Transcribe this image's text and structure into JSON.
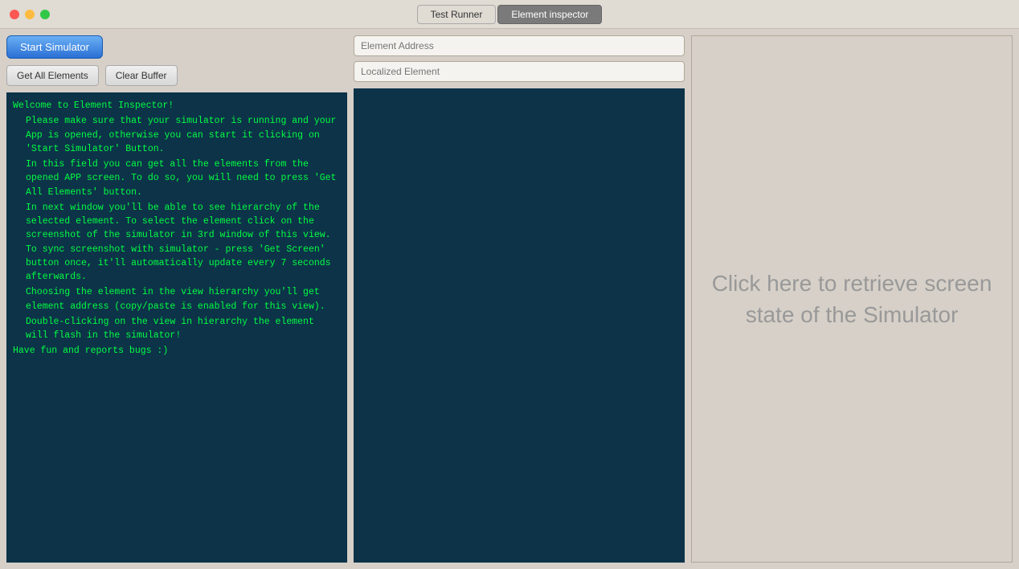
{
  "titleBar": {
    "tabs": [
      {
        "id": "test-runner",
        "label": "Test Runner",
        "active": false
      },
      {
        "id": "element-inspector",
        "label": "Element inspector",
        "active": true
      }
    ]
  },
  "leftPanel": {
    "startSimulatorButton": "Start Simulator",
    "getAllElementsButton": "Get All Elements",
    "clearBufferButton": "Clear Buffer",
    "logLines": [
      {
        "indent": false,
        "text": "Welcome to Element Inspector!"
      },
      {
        "indent": true,
        "text": "Please make sure that your simulator is running and your App is opened, otherwise you can start it clicking on 'Start Simulator' Button."
      },
      {
        "indent": true,
        "text": "In this field you can get all the elements from the opened APP screen. To do so, you will need to press 'Get All Elements' button."
      },
      {
        "indent": true,
        "text": "In next window you'll be able to see hierarchy of the selected element. To select the element click on the screenshot of the simulator in 3rd window of this view. To sync screenshot with simulator - press 'Get Screen' button once, it'll automatically update every 7 seconds afterwards."
      },
      {
        "indent": true,
        "text": "Choosing the element in the view hierarchy you'll get element address (copy/paste is enabled for this view)."
      },
      {
        "indent": true,
        "text": "Double-clicking on the view in hierarchy the element will flash in the simulator!"
      },
      {
        "indent": false,
        "text": "Have fun and reports bugs :)"
      }
    ]
  },
  "middlePanel": {
    "elementAddressPlaceholder": "Element Address",
    "localizedElementPlaceholder": "Localized Element"
  },
  "rightPanel": {
    "simulatorPlaceholder": "Click here to retrieve screen state of the Simulator"
  }
}
